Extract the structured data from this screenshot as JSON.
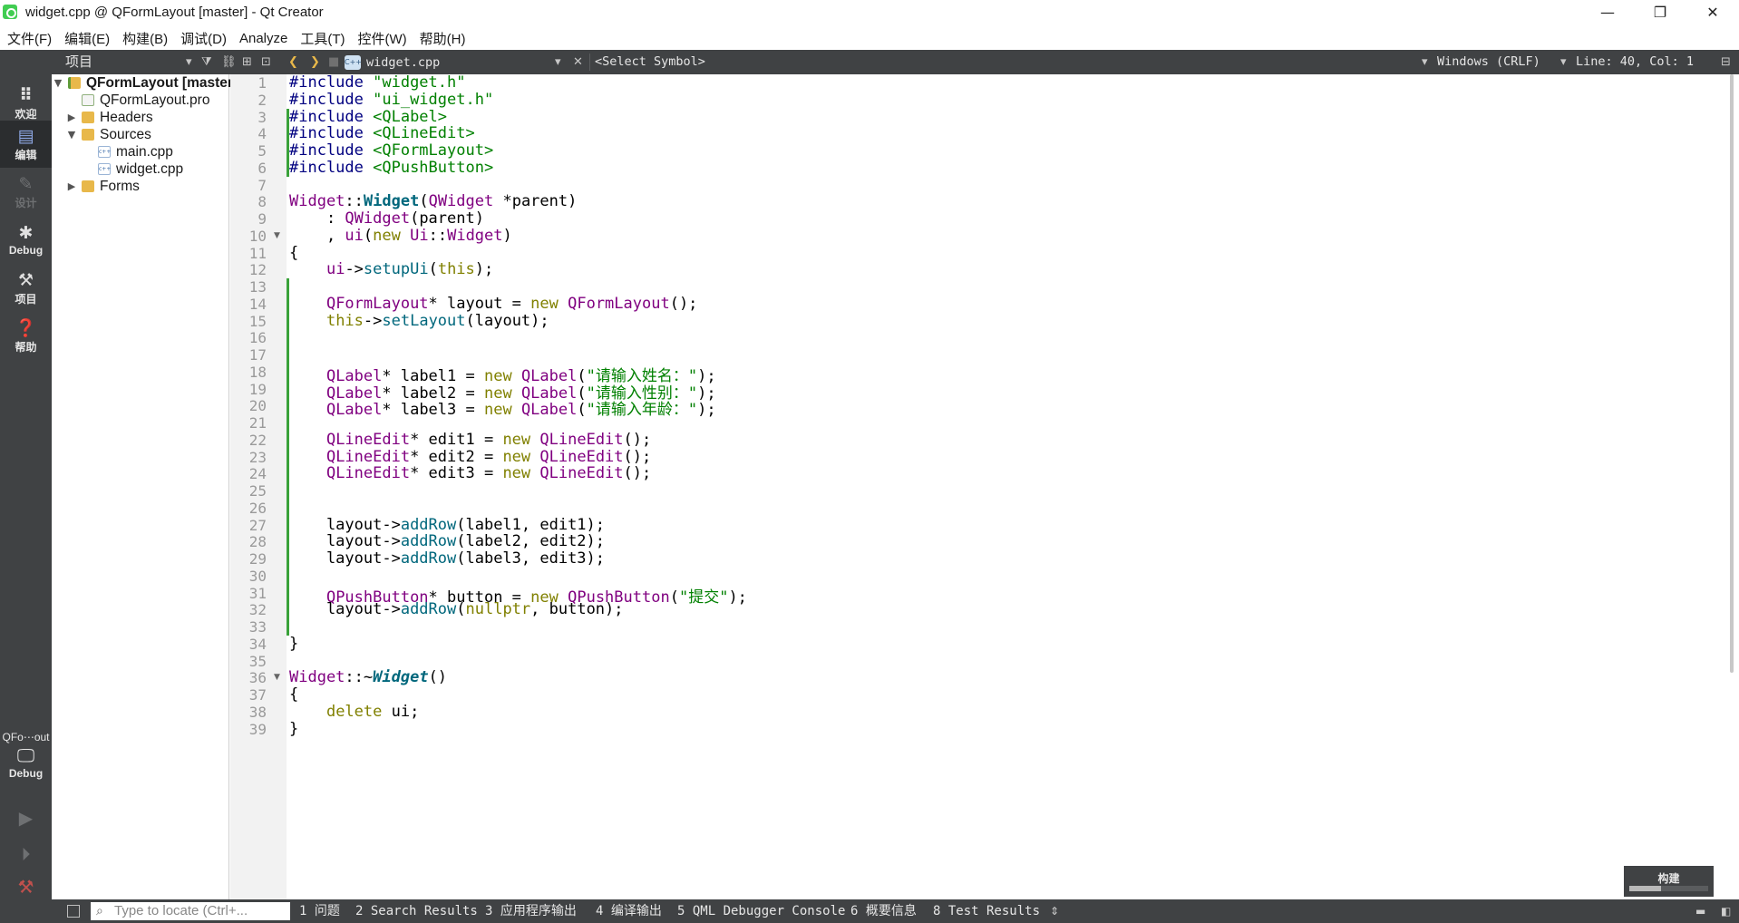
{
  "window": {
    "title": "widget.cpp @ QFormLayout [master] - Qt Creator",
    "controls": {
      "minimize": "—",
      "restore": "❐",
      "close": "✕"
    }
  },
  "menu": [
    "文件(F)",
    "编辑(E)",
    "构建(B)",
    "调试(D)",
    "Analyze",
    "工具(T)",
    "控件(W)",
    "帮助(H)"
  ],
  "toolbar": {
    "project_selector": "项目",
    "file_tab": "widget.cpp",
    "symbol_selector": "<Select Symbol>",
    "line_ending": "Windows (CRLF)",
    "cursor_position": "Line: 40, Col: 1"
  },
  "modes": [
    {
      "label": "欢迎",
      "icon": "grid-icon"
    },
    {
      "label": "编辑",
      "icon": "edit-icon",
      "active": true
    },
    {
      "label": "设计",
      "icon": "pencil-icon",
      "disabled": true
    },
    {
      "label": "Debug",
      "icon": "bug-icon"
    },
    {
      "label": "项目",
      "icon": "wrench-icon"
    },
    {
      "label": "帮助",
      "icon": "help-icon"
    }
  ],
  "kit": {
    "name": "QFo⋯out",
    "config": "Debug"
  },
  "project_tree": [
    {
      "label": "QFormLayout [master]",
      "level": 0,
      "expanded": true,
      "type": "project"
    },
    {
      "label": "QFormLayout.pro",
      "level": 1,
      "type": "pro-file"
    },
    {
      "label": "Headers",
      "level": 1,
      "expanded": false,
      "type": "folder"
    },
    {
      "label": "Sources",
      "level": 1,
      "expanded": true,
      "type": "folder"
    },
    {
      "label": "main.cpp",
      "level": 2,
      "type": "cpp-file"
    },
    {
      "label": "widget.cpp",
      "level": 2,
      "type": "cpp-file"
    },
    {
      "label": "Forms",
      "level": 1,
      "expanded": false,
      "type": "folder"
    }
  ],
  "code_lines": [
    "#include \"widget.h\"",
    "#include \"ui_widget.h\"",
    "#include <QLabel>",
    "#include <QLineEdit>",
    "#include <QFormLayout>",
    "#include <QPushButton>",
    "",
    "Widget::Widget(QWidget *parent)",
    "    : QWidget(parent)",
    "    , ui(new Ui::Widget)",
    "{",
    "    ui->setupUi(this);",
    "",
    "    QFormLayout* layout = new QFormLayout();",
    "    this->setLayout(layout);",
    "",
    "",
    "    QLabel* label1 = new QLabel(\"请输入姓名：\");",
    "    QLabel* label2 = new QLabel(\"请输入性别：\");",
    "    QLabel* label3 = new QLabel(\"请输入年龄：\");",
    "",
    "    QLineEdit* edit1 = new QLineEdit();",
    "    QLineEdit* edit2 = new QLineEdit();",
    "    QLineEdit* edit3 = new QLineEdit();",
    "",
    "",
    "    layout->addRow(label1, edit1);",
    "    layout->addRow(label2, edit2);",
    "    layout->addRow(label3, edit3);",
    "",
    "    QPushButton* button = new QPushButton(\"提交\");",
    "    layout->addRow(nullptr, button);",
    "",
    "}",
    "",
    "Widget::~Widget()",
    "{",
    "    delete ui;",
    "}"
  ],
  "build_widget": {
    "label": "构建",
    "progress": 0.4
  },
  "statusbar": {
    "locator_placeholder": "Type to locate (Ctrl+...",
    "panes": [
      "1 问题",
      "2 Search Results",
      "3 应用程序输出",
      "4 编译输出",
      "5 QML Debugger Console",
      "6 概要信息",
      "8 Test Results"
    ]
  },
  "colors": {
    "sidebar": "#404244",
    "keyword": "#808000",
    "type": "#800080",
    "function": "#00677c",
    "string": "#008000",
    "change_marker": "#3aa23a"
  }
}
